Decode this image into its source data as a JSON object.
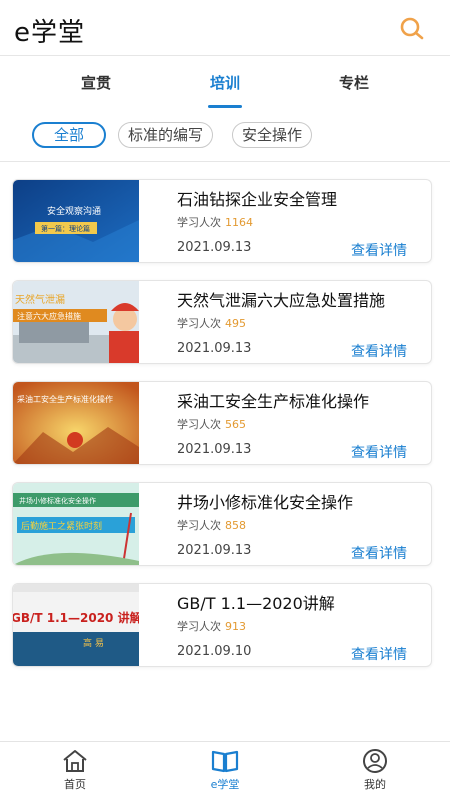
{
  "header": {
    "title": "e学堂",
    "search_icon": "search-icon"
  },
  "tabs": [
    {
      "label": "宣贯"
    },
    {
      "label": "培训"
    },
    {
      "label": "专栏"
    }
  ],
  "active_tab": "培训",
  "filters": [
    {
      "label": "全部"
    },
    {
      "label": "标准的编写"
    },
    {
      "label": "安全操作"
    }
  ],
  "learners_label": "学习人次",
  "detail_label": "查看详情",
  "courses": [
    {
      "title": "石油钻探企业安全管理",
      "learners": "1164",
      "date": "2021.09.13",
      "thumb_text": [
        "安全观察沟通",
        "第一篇：理论篇"
      ]
    },
    {
      "title": "天然气泄漏六大应急处置措施",
      "learners": "495",
      "date": "2021.09.13",
      "thumb_text": [
        "天然气泄漏",
        "注意六大应急措施"
      ]
    },
    {
      "title": "采油工安全生产标准化操作",
      "learners": "565",
      "date": "2021.09.13",
      "thumb_text": [
        "采油工安全生产标准化操作"
      ]
    },
    {
      "title": "井场小修标准化安全操作",
      "learners": "858",
      "date": "2021.09.13",
      "thumb_text": [
        "井场小修标准化安全操作",
        "后勤施工之紧张时刻"
      ]
    },
    {
      "title": "GB/T 1.1—2020讲解",
      "learners": "913",
      "date": "2021.09.10",
      "thumb_text": [
        "GB/T 1.1—2020 讲解",
        "高 易"
      ]
    }
  ],
  "bottom_nav": [
    {
      "label": "首页",
      "icon": "home-icon"
    },
    {
      "label": "e学堂",
      "icon": "book-icon"
    },
    {
      "label": "我的",
      "icon": "user-icon"
    }
  ],
  "colors": {
    "accent": "#1a7fd0",
    "count": "#e39a32",
    "search": "#f0a24a"
  }
}
